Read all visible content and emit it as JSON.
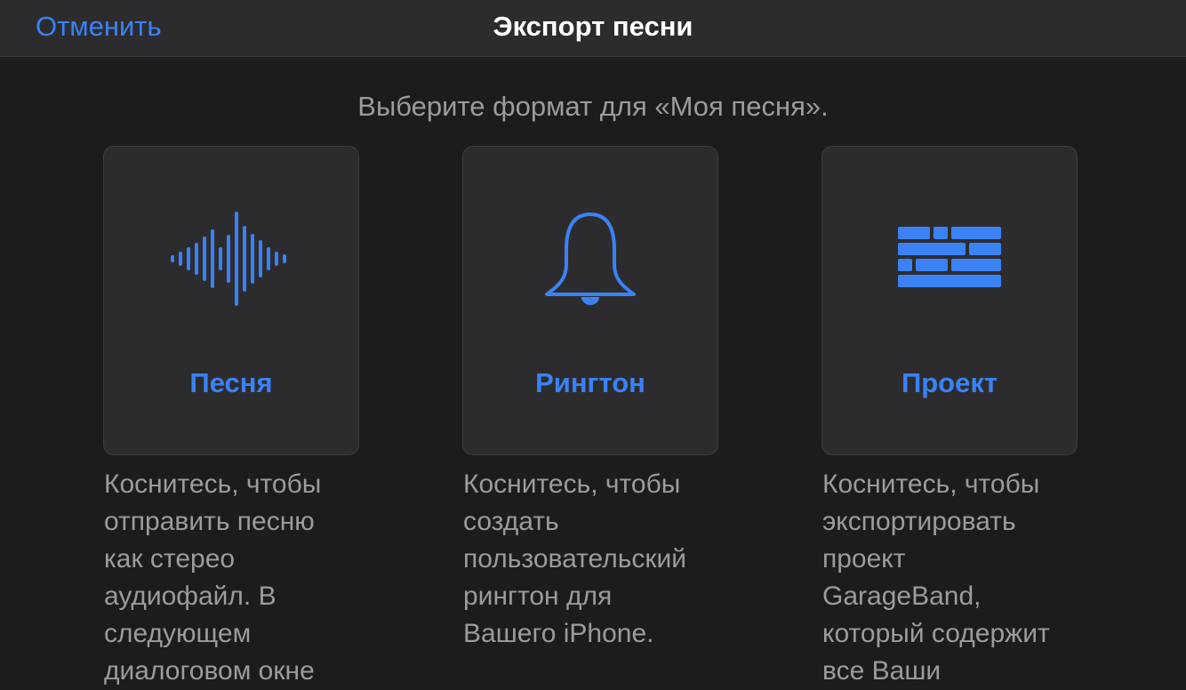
{
  "header": {
    "cancel_label": "Отменить",
    "title": "Экспорт песни"
  },
  "prompt": "Выберите формат для «Моя песня».",
  "accent_color": "#3b82f6",
  "options": [
    {
      "label": "Песня",
      "icon": "waveform-icon",
      "description": "Коснитесь, чтобы\nотправить песню\nкак стерео\nаудиофайл. В\nследующем\nдиалоговом окне"
    },
    {
      "label": "Рингтон",
      "icon": "bell-icon",
      "description": "Коснитесь, чтобы\nсоздать\nпользовательский\nрингтон для\nВашего iPhone."
    },
    {
      "label": "Проект",
      "icon": "bricks-icon",
      "description": "Коснитесь, чтобы\nэкспортировать\nпроект\nGarageBand,\nкоторый содержит\nвсе Ваши"
    }
  ]
}
